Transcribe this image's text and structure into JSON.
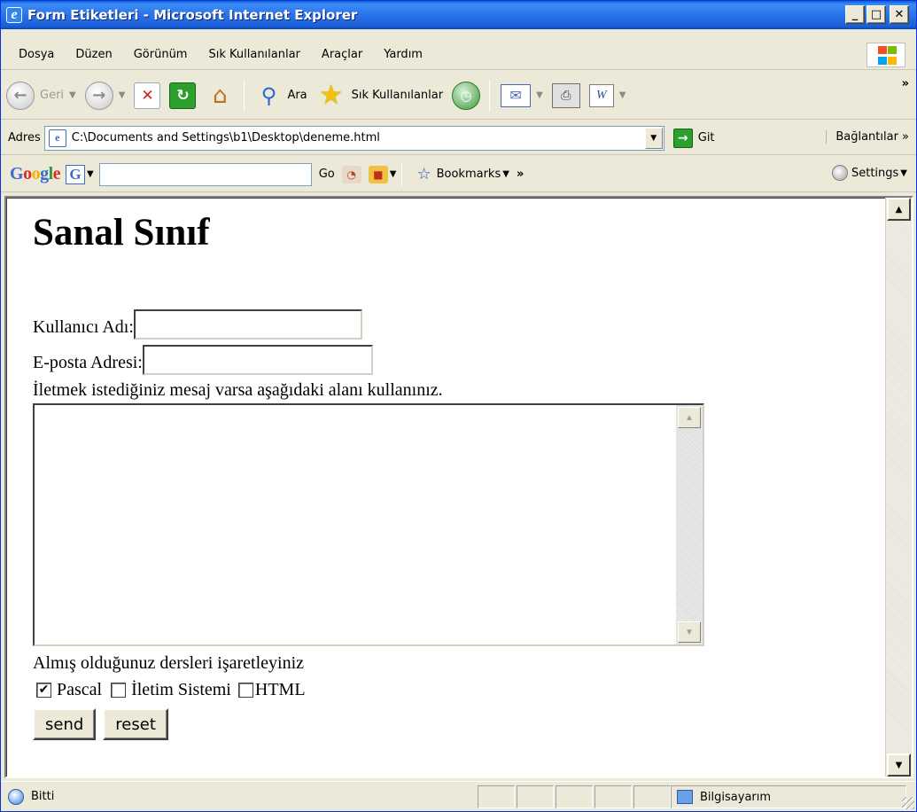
{
  "window": {
    "title": "Form Etiketleri - Microsoft Internet Explorer",
    "buttons": {
      "minimize": "_",
      "maximize": "□",
      "close": "✕"
    }
  },
  "menu": {
    "items": [
      "Dosya",
      "Düzen",
      "Görünüm",
      "Sık Kullanılanlar",
      "Araçlar",
      "Yardım"
    ]
  },
  "toolbar": {
    "back_label": "Geri",
    "search_label": "Ara",
    "favorites_label": "Sık Kullanılanlar",
    "overflow": "»"
  },
  "address": {
    "label": "Adres",
    "value": "C:\\Documents and Settings\\b1\\Desktop\\deneme.html",
    "go_label": "Git",
    "links_label": "Bağlantılar »"
  },
  "google": {
    "logo": "Google",
    "g_letter": "G",
    "go_label": "Go",
    "bookmarks_label": "Bookmarks",
    "overflow": "»",
    "settings_label": "Settings"
  },
  "page": {
    "heading": "Sanal Sınıf",
    "username_label": "Kullanıcı Adı:",
    "email_label": "E-posta Adresi:",
    "message_hint": "İletmek istediğiniz mesaj varsa aşağıdaki alanı kullanınız.",
    "courses_label": "Almış olduğunuz dersleri işaretleyiniz",
    "courses": [
      {
        "label": "Pascal",
        "checked": true
      },
      {
        "label": "İletim Sistemi",
        "checked": false
      },
      {
        "label": "HTML",
        "checked": false
      }
    ],
    "send_label": "send",
    "reset_label": "reset"
  },
  "status": {
    "text": "Bitti",
    "zone": "Bilgisayarım"
  },
  "colors": {
    "titlebar": "#2a73ea",
    "chrome": "#ece9d8",
    "page_bg": "#ffffff"
  }
}
